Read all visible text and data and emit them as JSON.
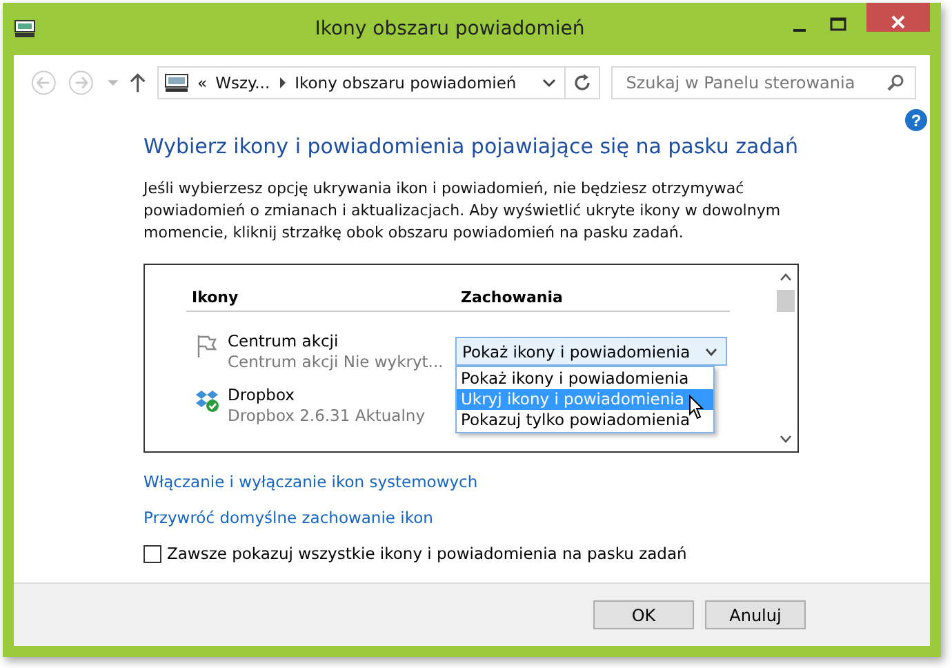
{
  "window": {
    "title": "Ikony obszaru powiadomień"
  },
  "address": {
    "prefix": "«",
    "crumbs": [
      "Wszy...",
      "Ikony obszaru powiadomień"
    ]
  },
  "search": {
    "placeholder": "Szukaj w Panelu sterowania"
  },
  "help": "?",
  "heading": "Wybierz ikony i powiadomienia pojawiające się na pasku zadań",
  "description": "Jeśli wybierzesz opcję ukrywania ikon i powiadomień, nie będziesz otrzymywać powiadomień o zmianach i aktualizacjach. Aby wyświetlić ukryte ikony w dowolnym momencie, kliknij strzałkę obok obszaru powiadomień na pasku zadań.",
  "table": {
    "columns": [
      "Ikony",
      "Zachowania"
    ],
    "rows": [
      {
        "kind": "flag",
        "name": "Centrum akcji",
        "detail": "Centrum akcji  Nie wykryt...",
        "behavior": "Pokaż ikony i powiadomienia"
      },
      {
        "kind": "box",
        "name": "Dropbox",
        "detail": "Dropbox 2.6.31 Aktualny"
      }
    ]
  },
  "dropdown_options": [
    {
      "label": "Pokaż ikony i powiadomienia",
      "selected": false
    },
    {
      "label": "Ukryj ikony i powiadomienia",
      "selected": true
    },
    {
      "label": "Pokazuj tylko powiadomienia",
      "selected": false
    }
  ],
  "links": [
    "Włączanie i wyłączanie ikon systemowych",
    "Przywróć domyślne zachowanie ikon"
  ],
  "always_show": {
    "label": "Zawsze pokazuj wszystkie ikony i powiadomienia na pasku zadań",
    "checked": false
  },
  "buttons": [
    "OK",
    "Anuluj"
  ]
}
